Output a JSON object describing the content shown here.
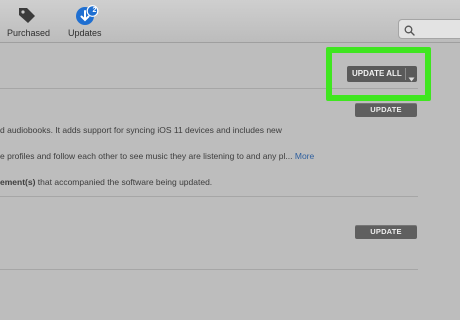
{
  "toolbar": {
    "purchased_label": "Purchased",
    "updates_label": "Updates",
    "updates_badge": "2"
  },
  "header": {
    "update_all_label": "UPDATE ALL"
  },
  "updates": [
    {
      "button_label": "UPDATE",
      "line1": "d audiobooks. It adds support for syncing iOS 11 devices and includes new",
      "line2": "e profiles and follow each other to see music they are listening to and any pl...",
      "more_label": "More",
      "line3_bold": "ement(s)",
      "line3_rest": " that accompanied the software being updated."
    },
    {
      "button_label": "UPDATE"
    }
  ],
  "colors": {
    "highlight": "#3fe620",
    "link": "#2e5f9e",
    "badge": "#1f6fd1"
  }
}
